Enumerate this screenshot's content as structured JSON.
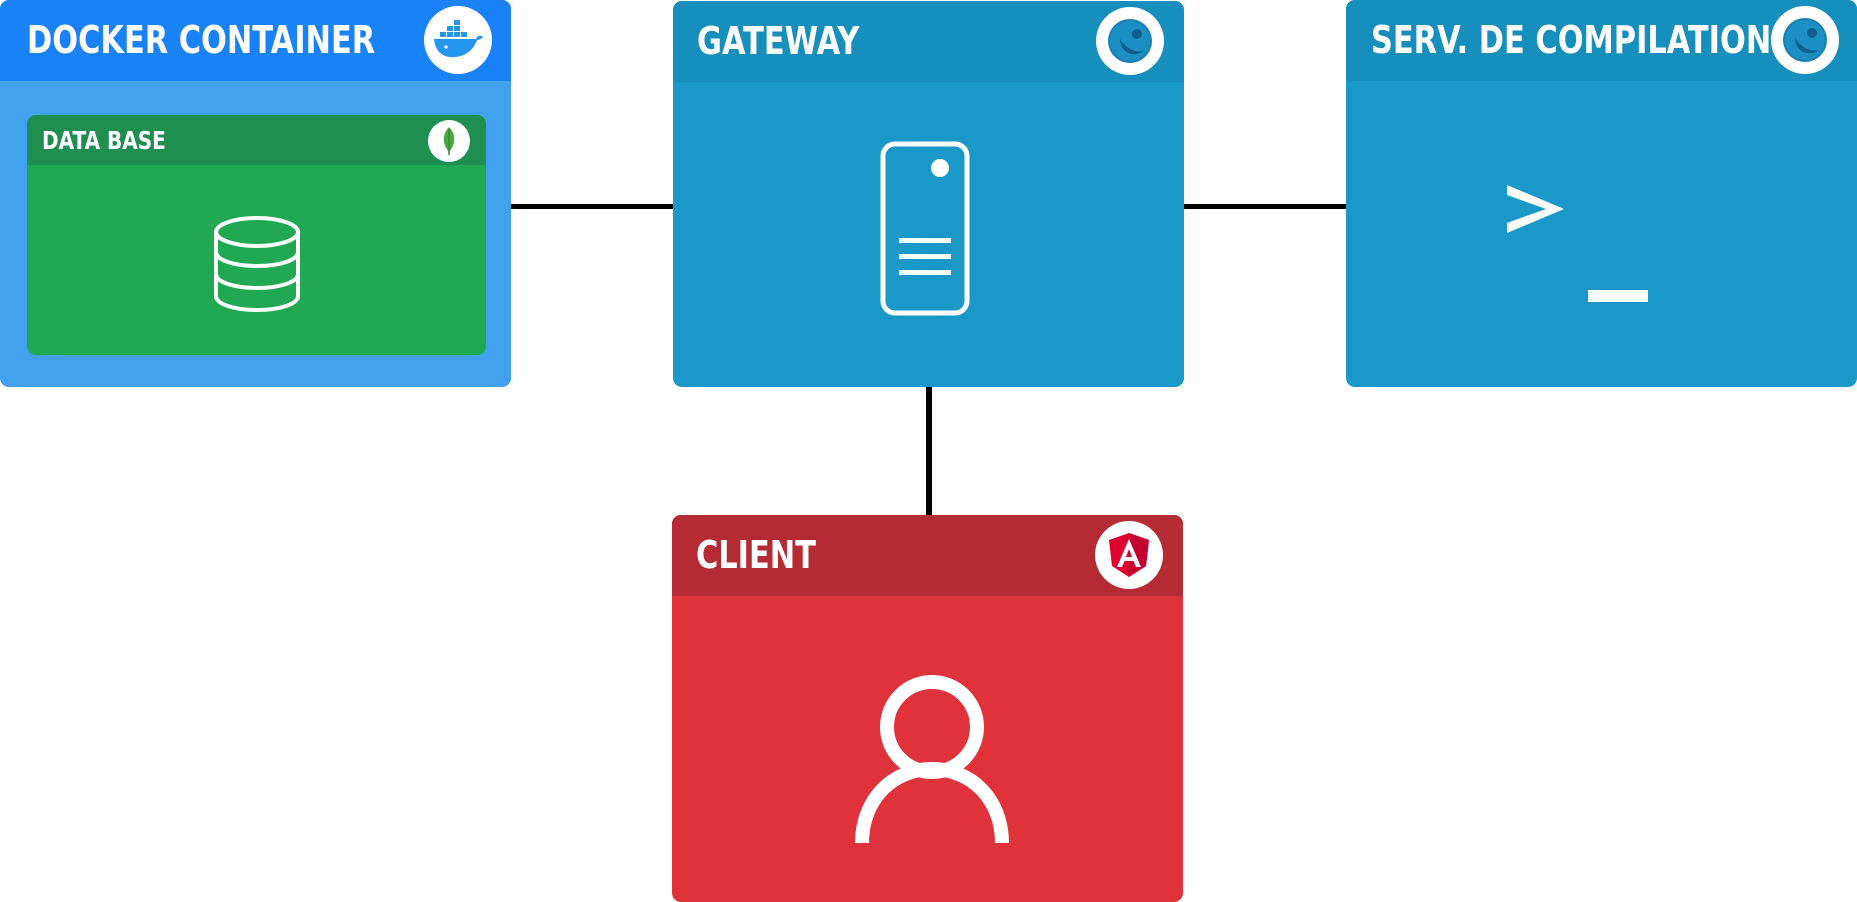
{
  "boxes": {
    "docker": {
      "title": "DOCKER CONTAINER",
      "icon": "docker-whale-icon",
      "color": "#42a1ec",
      "header_color": "#1a82f7"
    },
    "database": {
      "title": "DATA BASE",
      "icon": "mongodb-leaf-icon",
      "content_icon": "database-icon",
      "color": "#21a852",
      "header_color": "#1f8f51"
    },
    "gateway": {
      "title": "GATEWAY",
      "icon": "blue-circle-icon",
      "content_icon": "server-icon",
      "color": "#1a99c8",
      "header_color": "#178fbd"
    },
    "compile": {
      "title": "SERV. DE COMPILATION",
      "icon": "blue-circle-icon",
      "content_icon": "terminal-icon",
      "color": "#1a99c8",
      "header_color": "#178fbd"
    },
    "client": {
      "title": "CLIENT",
      "icon": "angular-icon",
      "content_icon": "user-icon",
      "color": "#df323b",
      "header_color": "#b52b33"
    }
  },
  "terminal_prompt": ">_"
}
